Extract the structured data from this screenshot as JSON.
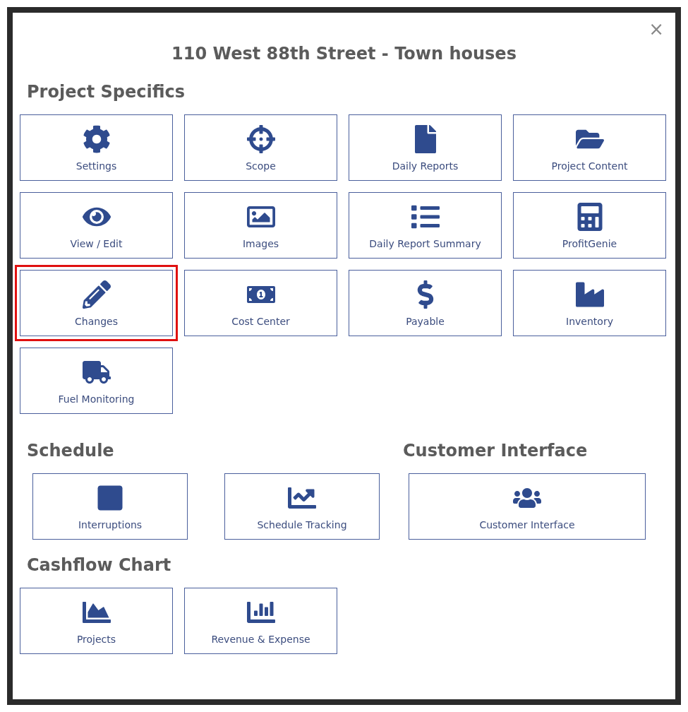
{
  "dialog": {
    "title": "110 West 88th Street - Town houses",
    "close": "×"
  },
  "project_specifics": {
    "heading": "Project Specifics",
    "tiles": [
      {
        "kind": "gear",
        "label": "Settings",
        "highlighted": false
      },
      {
        "kind": "crosshairs",
        "label": "Scope",
        "highlighted": false
      },
      {
        "kind": "file",
        "label": "Daily Reports",
        "highlighted": false
      },
      {
        "kind": "folder",
        "label": "Project Content",
        "highlighted": false
      },
      {
        "kind": "eye",
        "label": "View / Edit",
        "highlighted": false
      },
      {
        "kind": "image",
        "label": "Images",
        "highlighted": false
      },
      {
        "kind": "list",
        "label": "Daily Report Summary",
        "highlighted": false
      },
      {
        "kind": "calculator",
        "label": "ProfitGenie",
        "highlighted": false
      },
      {
        "kind": "pencil",
        "label": "Changes",
        "highlighted": true
      },
      {
        "kind": "money",
        "label": "Cost Center",
        "highlighted": false
      },
      {
        "kind": "dollar",
        "label": "Payable",
        "highlighted": false
      },
      {
        "kind": "factory",
        "label": "Inventory",
        "highlighted": false
      },
      {
        "kind": "truck",
        "label": "Fuel Monitoring",
        "highlighted": false
      }
    ]
  },
  "schedule": {
    "heading": "Schedule",
    "tiles": [
      {
        "kind": "square",
        "label": "Interruptions",
        "highlighted": false
      },
      {
        "kind": "trend",
        "label": "Schedule Tracking",
        "highlighted": false
      }
    ]
  },
  "customer_interface": {
    "heading": "Customer Interface",
    "tiles": [
      {
        "kind": "users",
        "label": "Customer Interface",
        "highlighted": false
      }
    ]
  },
  "cashflow_chart": {
    "heading": "Cashflow Chart",
    "tiles": [
      {
        "kind": "area",
        "label": "Projects",
        "highlighted": false
      },
      {
        "kind": "bars",
        "label": "Revenue & Expense",
        "highlighted": false
      }
    ]
  }
}
